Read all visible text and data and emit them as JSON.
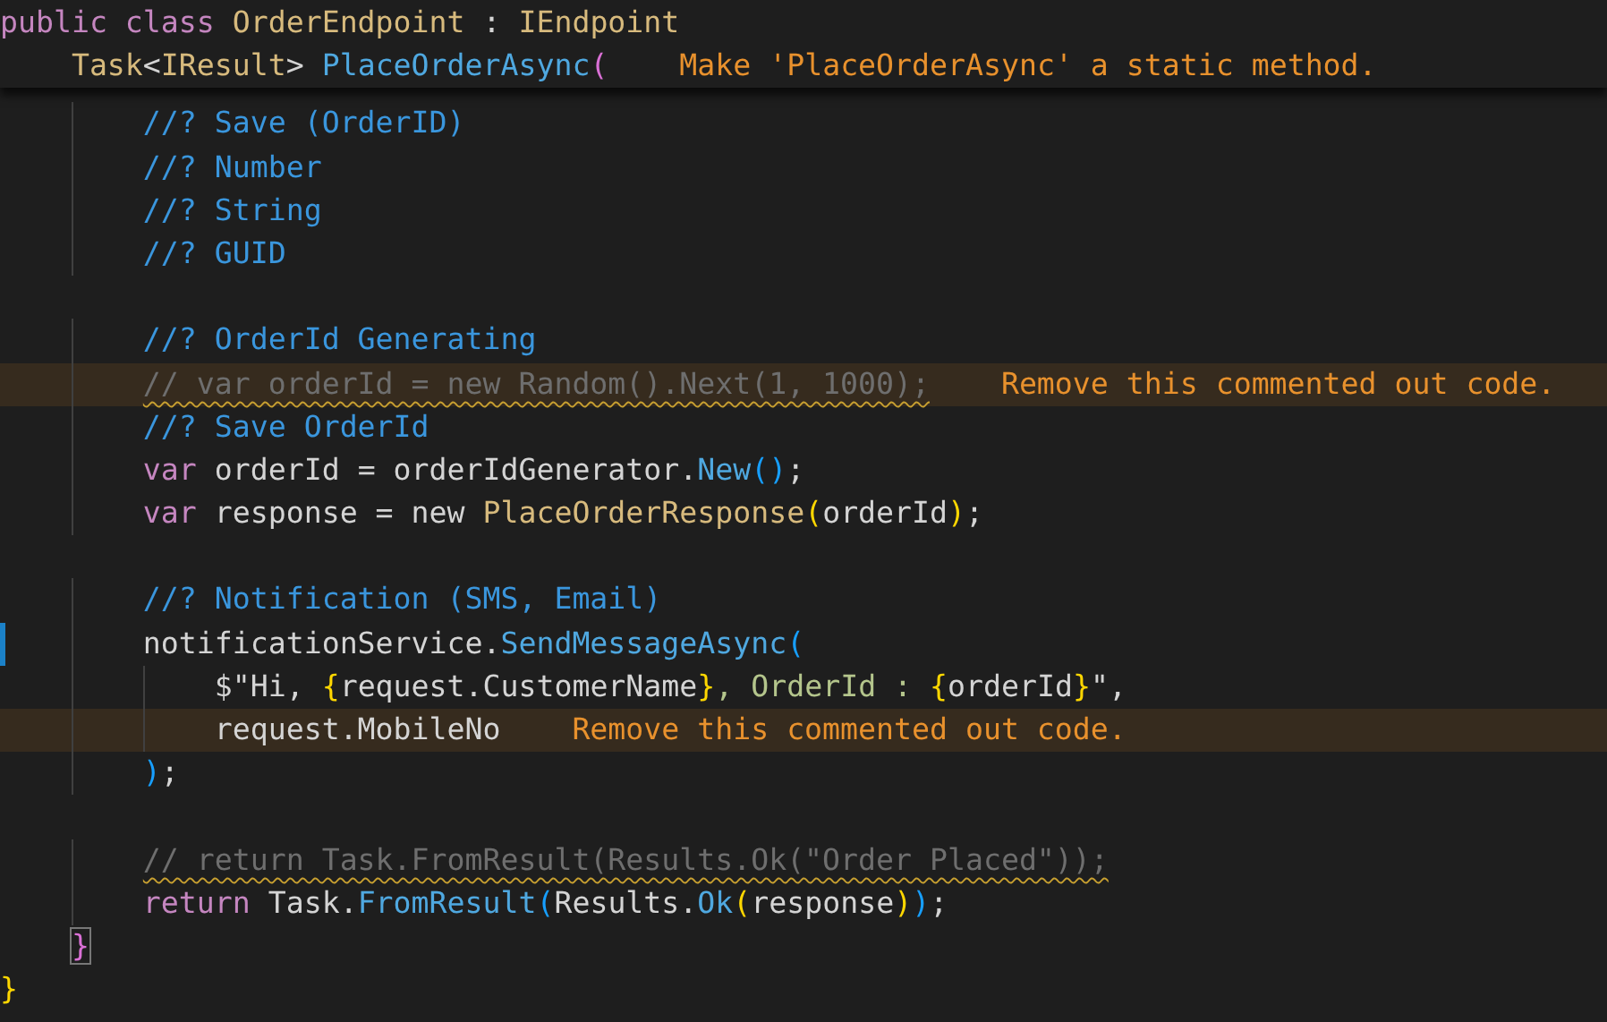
{
  "sticky_header": {
    "lines": [
      {
        "kind": "code",
        "tokens": [
          {
            "text": "public class ",
            "kind": "keyword"
          },
          {
            "text": "OrderEndpoint",
            "kind": "type"
          },
          {
            "text": " : ",
            "kind": "plain"
          },
          {
            "text": "IEndpoint",
            "kind": "type"
          }
        ]
      },
      {
        "kind": "code",
        "tokens": [
          {
            "text": "    Task",
            "kind": "type"
          },
          {
            "text": "<",
            "kind": "plain"
          },
          {
            "text": "IResult",
            "kind": "type"
          },
          {
            "text": "> ",
            "kind": "plain"
          },
          {
            "text": "PlaceOrderAsync",
            "kind": "method"
          },
          {
            "text": "(",
            "kind": "bracket-pink"
          }
        ],
        "warning": "Make 'PlaceOrderAsync' a static method."
      }
    ]
  },
  "editor": {
    "lines": [
      {
        "kind": "code",
        "tokens": [
          {
            "text": "        //? Save (OrderID)",
            "kind": "doc-comment"
          }
        ]
      },
      {
        "kind": "code",
        "tokens": [
          {
            "text": "        //? Number",
            "kind": "doc-comment"
          }
        ]
      },
      {
        "kind": "code",
        "tokens": [
          {
            "text": "        //? String",
            "kind": "doc-comment"
          }
        ]
      },
      {
        "kind": "code",
        "tokens": [
          {
            "text": "        //? GUID",
            "kind": "doc-comment"
          }
        ]
      },
      {
        "kind": "blank"
      },
      {
        "kind": "code",
        "tokens": [
          {
            "text": "        //? OrderId Generating",
            "kind": "doc-comment"
          }
        ]
      },
      {
        "kind": "code",
        "highlighted": true,
        "tokens": [
          {
            "text": "        // var orderId = new Random().Next(1, 1000);",
            "kind": "dead-comment",
            "squiggle": true
          }
        ],
        "warning": "Remove this commented out code."
      },
      {
        "kind": "code",
        "tokens": [
          {
            "text": "        //? Save OrderId",
            "kind": "doc-comment"
          }
        ]
      },
      {
        "kind": "code",
        "tokens": [
          {
            "text": "        var ",
            "kind": "keyword"
          },
          {
            "text": "orderId = orderIdGenerator.",
            "kind": "plain"
          },
          {
            "text": "New",
            "kind": "method"
          },
          {
            "text": "()",
            "kind": "bracket-blue"
          },
          {
            "text": ";",
            "kind": "plain"
          }
        ]
      },
      {
        "kind": "code",
        "tokens": [
          {
            "text": "        var ",
            "kind": "keyword"
          },
          {
            "text": "response = new ",
            "kind": "plain"
          },
          {
            "text": "PlaceOrderResponse",
            "kind": "type"
          },
          {
            "text": "(",
            "kind": "bracket-yellow"
          },
          {
            "text": "orderId",
            "kind": "plain"
          },
          {
            "text": ")",
            "kind": "bracket-yellow"
          },
          {
            "text": ";",
            "kind": "plain"
          }
        ]
      },
      {
        "kind": "blank"
      },
      {
        "kind": "code",
        "tokens": [
          {
            "text": "        //? Notification (SMS, Email)",
            "kind": "doc-comment"
          }
        ]
      },
      {
        "kind": "code",
        "modified": true,
        "tokens": [
          {
            "text": "        notificationService.",
            "kind": "plain"
          },
          {
            "text": "SendMessageAsync",
            "kind": "method"
          },
          {
            "text": "(",
            "kind": "bracket-blue"
          }
        ]
      },
      {
        "kind": "code",
        "tokens": [
          {
            "text": "            $\"Hi, ",
            "kind": "plain"
          },
          {
            "text": "{",
            "kind": "bracket-yellow"
          },
          {
            "text": "request.CustomerName",
            "kind": "plain"
          },
          {
            "text": "}",
            "kind": "bracket-yellow"
          },
          {
            "text": ", OrderId : ",
            "kind": "string"
          },
          {
            "text": "{",
            "kind": "bracket-yellow"
          },
          {
            "text": "orderId",
            "kind": "plain"
          },
          {
            "text": "}",
            "kind": "bracket-yellow"
          },
          {
            "text": "\",",
            "kind": "plain"
          }
        ]
      },
      {
        "kind": "code",
        "highlighted": true,
        "tokens": [
          {
            "text": "            request.MobileNo",
            "kind": "plain"
          }
        ],
        "warning": "Remove this commented out code."
      },
      {
        "kind": "code",
        "tokens": [
          {
            "text": "        )",
            "kind": "bracket-blue"
          },
          {
            "text": ";",
            "kind": "plain"
          }
        ]
      },
      {
        "kind": "blank"
      },
      {
        "kind": "code",
        "tokens": [
          {
            "text": "        // return Task.FromResult(Results.Ok(\"Order Placed\"));",
            "kind": "dead-comment",
            "squiggle": true
          }
        ]
      },
      {
        "kind": "code",
        "tokens": [
          {
            "text": "        return ",
            "kind": "keyword"
          },
          {
            "text": "Task.",
            "kind": "plain"
          },
          {
            "text": "FromResult",
            "kind": "method"
          },
          {
            "text": "(",
            "kind": "bracket-blue"
          },
          {
            "text": "Results.",
            "kind": "plain"
          },
          {
            "text": "Ok",
            "kind": "method"
          },
          {
            "text": "(",
            "kind": "bracket-yellow"
          },
          {
            "text": "response",
            "kind": "plain"
          },
          {
            "text": ")",
            "kind": "bracket-yellow"
          },
          {
            "text": ")",
            "kind": "bracket-blue"
          },
          {
            "text": ";",
            "kind": "plain"
          }
        ]
      },
      {
        "kind": "code",
        "tokens": [
          {
            "text": "    }",
            "kind": "bracket-pink",
            "boxed": true
          }
        ]
      },
      {
        "kind": "code",
        "tokens": [
          {
            "text": "}",
            "kind": "bracket-yellow"
          }
        ]
      }
    ]
  }
}
